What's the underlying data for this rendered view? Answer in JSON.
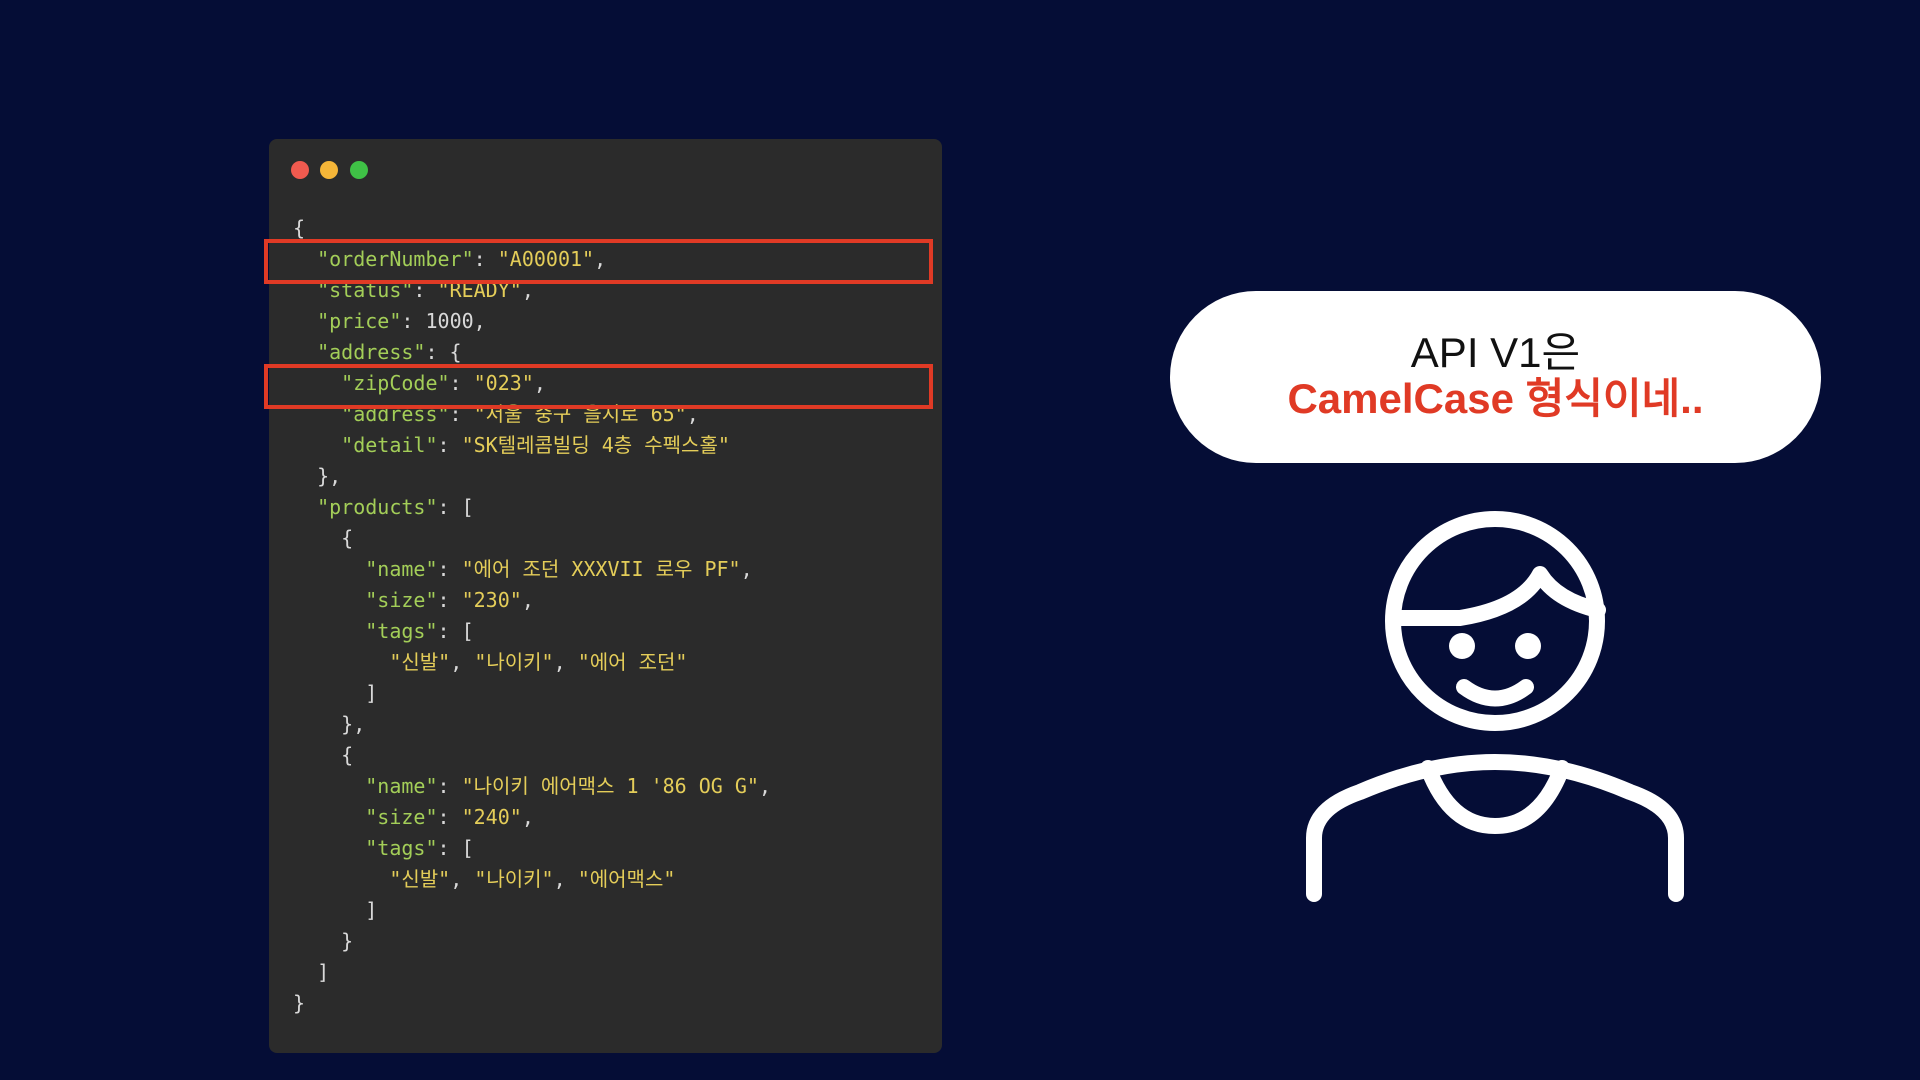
{
  "colors": {
    "background": "#050d36",
    "editor_background": "#2b2b2b",
    "json_key": "#a3ce58",
    "json_string": "#e4cd59",
    "highlight": "#e03a25",
    "bubble_background": "#ffffff",
    "bubble_accent": "#e03a25",
    "avatar_stroke": "#ffffff"
  },
  "window_controls": [
    "close",
    "minimize",
    "maximize"
  ],
  "json_code": {
    "order_number_key": "\"orderNumber\"",
    "order_number_value": "\"A00001\"",
    "status_key": "\"status\"",
    "status_value": "\"READY\"",
    "price_key": "\"price\"",
    "price_value": "1000",
    "address_key": "\"address\"",
    "zip_code_key": "\"zipCode\"",
    "zip_code_value": "\"023\"",
    "address_inner_key": "\"address\"",
    "address_inner_value": "\"서울 중구 을지로 65\"",
    "detail_key": "\"detail\"",
    "detail_value": "\"SK텔레콤빌딩 4층 수펙스홀\"",
    "products_key": "\"products\"",
    "product1": {
      "name_key": "\"name\"",
      "name_value": "\"에어 조던 XXXVII 로우 PF\"",
      "size_key": "\"size\"",
      "size_value": "\"230\"",
      "tags_key": "\"tags\"",
      "tags": [
        "\"신발\"",
        "\"나이키\"",
        "\"에어 조던\""
      ]
    },
    "product2": {
      "name_key": "\"name\"",
      "name_value": "\"나이키 에어맥스 1 '86 OG G\"",
      "size_key": "\"size\"",
      "size_value": "\"240\"",
      "tags_key": "\"tags\"",
      "tags": [
        "\"신발\"",
        "\"나이키\"",
        "\"에어맥스\""
      ]
    }
  },
  "speech_bubble": {
    "line1": "API V1은",
    "line2": "CamelCase 형식이네.."
  },
  "avatar_icon": "person-icon"
}
